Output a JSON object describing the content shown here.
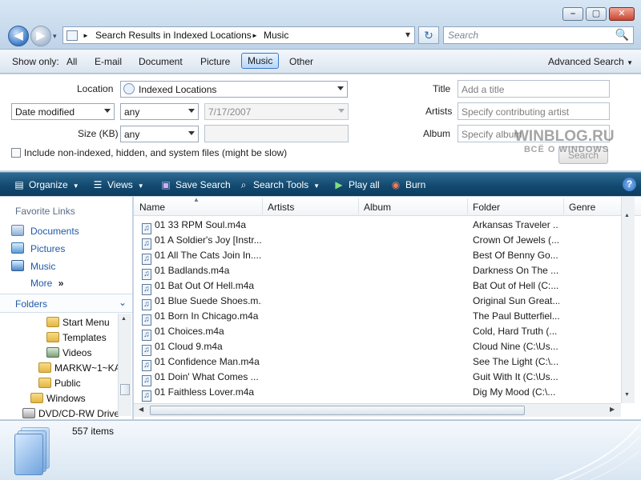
{
  "window": {
    "minimize": "–",
    "maximize": "▢",
    "close": "✕"
  },
  "nav": {
    "back": "◀",
    "forward": "▶",
    "recent": "▾",
    "refresh": "↻"
  },
  "address": {
    "crumbs": [
      "Search Results in Indexed Locations",
      "Music"
    ],
    "separator": "►",
    "drop": "▾"
  },
  "search": {
    "placeholder": "Search",
    "icon": "🔍"
  },
  "show_only": {
    "label": "Show only:",
    "options": [
      "All",
      "E-mail",
      "Document",
      "Picture",
      "Music",
      "Other"
    ],
    "selected": "Music",
    "advanced": "Advanced Search"
  },
  "filters": {
    "location_label": "Location",
    "location_value": "Indexed Locations",
    "date_field": "Date modified",
    "date_op": "any",
    "date_value": "7/17/2007",
    "size_label": "Size (KB)",
    "size_op": "any",
    "title_label": "Title",
    "title_placeholder": "Add a title",
    "artists_label": "Artists",
    "artists_placeholder": "Specify contributing artist",
    "album_label": "Album",
    "album_placeholder": "Specify album",
    "include_label": "Include non-indexed, hidden, and system files (might be slow)",
    "search_button": "Search"
  },
  "toolbar": {
    "organize": "Organize",
    "views": "Views",
    "save_search": "Save Search",
    "search_tools": "Search Tools",
    "play_all": "Play all",
    "burn": "Burn",
    "help": "?"
  },
  "favorites": {
    "title": "Favorite Links",
    "items": [
      "Documents",
      "Pictures",
      "Music",
      "More"
    ],
    "more_glyph": "»"
  },
  "folders": {
    "title": "Folders",
    "items": [
      "Start Menu",
      "Templates",
      "Videos",
      "MARKW~1~KA",
      "Public",
      "Windows",
      "DVD/CD-RW Drive"
    ]
  },
  "columns": [
    "Name",
    "Artists",
    "Album",
    "Folder",
    "Genre"
  ],
  "rows": [
    {
      "name": "01 33 RPM Soul.m4a",
      "folder": "Arkansas Traveler ..."
    },
    {
      "name": "01 A Soldier's Joy [Instr...",
      "folder": "Crown Of Jewels (..."
    },
    {
      "name": "01 All The Cats Join In....",
      "folder": "Best Of Benny Go..."
    },
    {
      "name": "01 Badlands.m4a",
      "folder": "Darkness On The ..."
    },
    {
      "name": "01 Bat Out Of Hell.m4a",
      "folder": "Bat Out of Hell (C:..."
    },
    {
      "name": "01 Blue Suede Shoes.m...",
      "folder": "Original Sun Great..."
    },
    {
      "name": "01 Born In Chicago.m4a",
      "folder": "The Paul Butterfiel..."
    },
    {
      "name": "01 Choices.m4a",
      "folder": "Cold, Hard Truth (..."
    },
    {
      "name": "01 Cloud 9.m4a",
      "folder": "Cloud Nine (C:\\Us..."
    },
    {
      "name": "01 Confidence Man.m4a",
      "folder": "See The Light (C:\\..."
    },
    {
      "name": "01 Doin' What Comes ...",
      "folder": "Guit With It (C:\\Us..."
    },
    {
      "name": "01 Faithless Lover.m4a",
      "folder": "Dig My Mood (C:\\..."
    }
  ],
  "status": {
    "count": "557 items"
  },
  "watermark": {
    "line1": "WINBLOG.RU",
    "line2": "ВСЁ О WINDOWS"
  },
  "colors": {
    "toolbar": "#134a71",
    "accent": "#1f5aa6"
  }
}
